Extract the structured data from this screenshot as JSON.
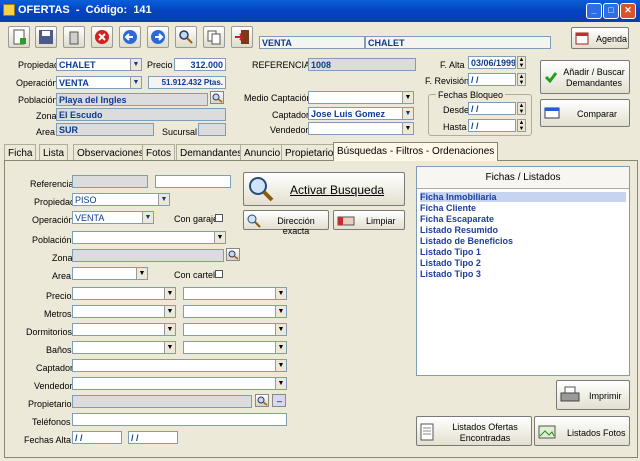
{
  "window": {
    "title": "OFERTAS",
    "code_label": "Código:",
    "code": "141"
  },
  "header": {
    "venta": "VENTA",
    "chalet": "CHALET",
    "agenda": "Agenda"
  },
  "main": {
    "propiedad_label": "Propiedad",
    "propiedad": "CHALET",
    "precio_label": "Precio",
    "precio": "312.000",
    "referencia_label": "REFERENCIA",
    "referencia": "1008",
    "operacion_label": "Operación",
    "operacion": "VENTA",
    "ptas": "51.912.432 Ptas.",
    "poblacion_label": "Población",
    "poblacion": "Playa del Ingles",
    "zona_label": "Zona",
    "zona": "El Escudo",
    "area_label": "Area",
    "area": "SUR",
    "sucursal_label": "Sucursal",
    "sucursal": "",
    "medio_label": "Medio Captación",
    "medio": "",
    "captador_label": "Captador",
    "captador": "Jose Luis Gomez",
    "vendedor_label": "Vendedor",
    "vendedor": "",
    "falta_label": "F. Alta",
    "falta": "03/06/1999",
    "frevision_label": "F. Revisión",
    "frevision": "/ /",
    "fechas_bloqueo": "Fechas Bloqueo",
    "desde_label": "Desde",
    "desde": "/ /",
    "hasta_label": "Hasta",
    "hasta": "/ /",
    "btn_anadir": "Añadir / Buscar Demandantes",
    "btn_comparar": "Comparar"
  },
  "tabs": [
    "Ficha",
    "Lista",
    "Observaciones",
    "Fotos",
    "Demandantes",
    "Anuncio",
    "Propietario",
    "Búsquedas - Filtros - Ordenaciones"
  ],
  "search": {
    "referencia": "Referencia",
    "propiedad": "Propiedad",
    "propiedad_val": "PISO",
    "operacion": "Operación",
    "operacion_val": "VENTA",
    "con_garaje": "Con garaje",
    "poblacion": "Población",
    "zona": "Zona",
    "area": "Area",
    "con_cartel": "Con cartel",
    "precio": "Precio",
    "metros": "Metros",
    "dormitorios": "Dormitorios",
    "banos": "Baños",
    "captador": "Captador",
    "vendedor": "Vendedor",
    "propietario": "Propietario",
    "telefonos": "Teléfonos",
    "fechas_alta": "Fechas Alta",
    "date1": "/ /",
    "date2": "/ /",
    "activar": "Activar Busqueda",
    "direccion": "Dirección exacta",
    "limpiar": "Limpiar"
  },
  "fichas": {
    "header": "Fichas / Listados",
    "items": [
      "Ficha Inmobiliaria",
      "Ficha Cliente",
      "Ficha Escaparate",
      "Listado Resumido",
      "Listado de Beneficios",
      "Listado Tipo 1",
      "Listado Tipo 2",
      "Listado Tipo 3"
    ],
    "imprimir": "Imprimir",
    "listados_ofertas": "Listados Ofertas Encontradas",
    "listados_fotos": "Listados Fotos"
  }
}
